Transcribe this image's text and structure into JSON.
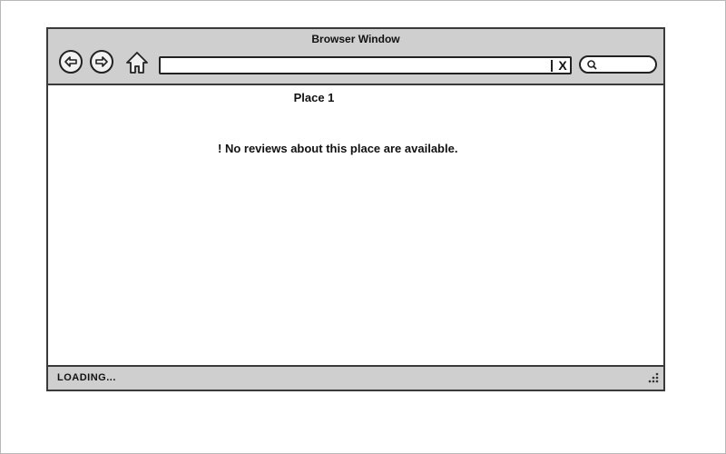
{
  "window": {
    "title": "Browser Window"
  },
  "toolbar": {
    "back_icon": "back-arrow-icon",
    "forward_icon": "forward-arrow-icon",
    "home_icon": "home-icon",
    "url_value": "",
    "clear_label": "X",
    "search_icon": "search-icon",
    "search_value": ""
  },
  "page": {
    "title": "Place 1",
    "notice": "! No reviews about this place are available."
  },
  "status": {
    "text": "LOADING..."
  },
  "colors": {
    "chrome": "#cfcfcf",
    "border": "#3a3a3a",
    "content": "#ffffff"
  }
}
